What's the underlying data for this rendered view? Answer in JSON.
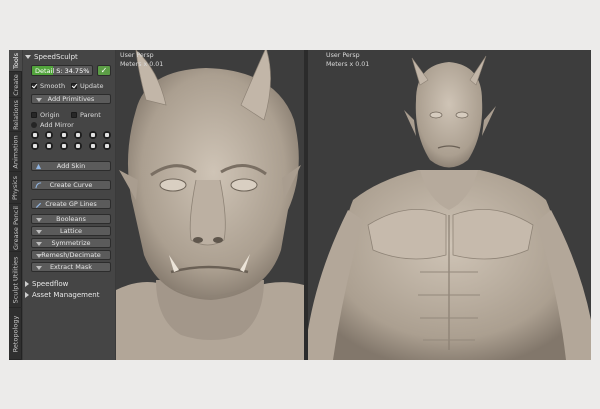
{
  "side_tabs": [
    "Tools",
    "Create",
    "Relations",
    "Animation",
    "Physics",
    "Grease Pencil",
    "Sculpt Utilities",
    "Retopology"
  ],
  "panel": {
    "title": "SpeedSculpt",
    "detail_label": "Detail S: 34.75%",
    "detail_fraction": 0.35,
    "smooth_label": "Smooth",
    "update_label": "Update",
    "add_primitives": "Add Primitives",
    "origin_label": "Origin",
    "parent_label": "Parent",
    "add_mirror_label": "Add Mirror",
    "add_skin": "Add Skin",
    "create_curve": "Create Curve",
    "create_gp_lines": "Create GP Lines",
    "sections": [
      "Booleans",
      "Lattice",
      "Symmetrize",
      "Remesh/Decimate",
      "Extract Mask"
    ],
    "speedflow": "Speedflow",
    "asset_management": "Asset Management"
  },
  "viewport_left": {
    "title": "User Persp",
    "info": "Meters x 0.01"
  },
  "viewport_right": {
    "title": "User Persp",
    "info": "Meters x 0.01"
  },
  "colors": {
    "accent_green": "#52a43c",
    "viewport_bg": "#3d3d3d",
    "clay": "#bdb1a3"
  }
}
